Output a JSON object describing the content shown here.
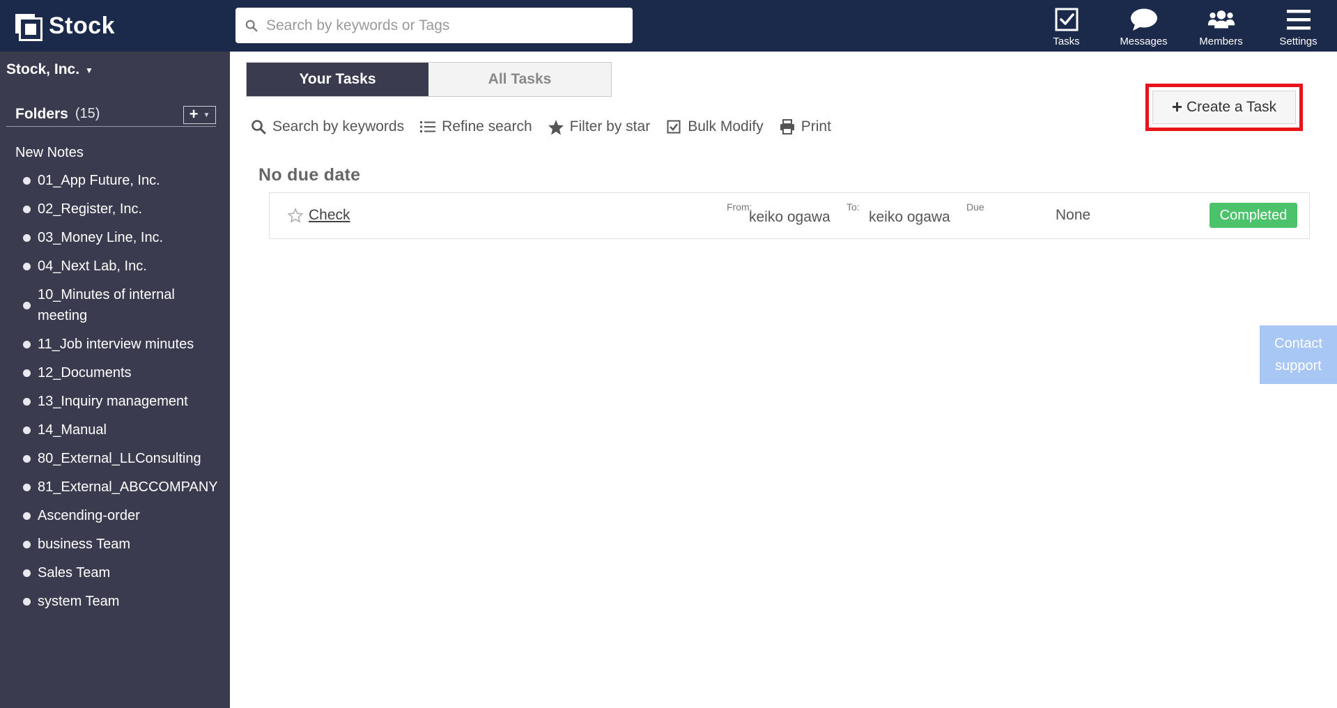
{
  "app": {
    "name": "Stock"
  },
  "header": {
    "search_placeholder": "Search by keywords or Tags",
    "nav": [
      {
        "label": "Tasks",
        "icon": "tasks-checkbox-icon"
      },
      {
        "label": "Messages",
        "icon": "chat-bubble-icon"
      },
      {
        "label": "Members",
        "icon": "members-group-icon"
      },
      {
        "label": "Settings",
        "icon": "hamburger-menu-icon"
      }
    ]
  },
  "sidebar": {
    "org_name": "Stock, Inc.",
    "folders_label": "Folders",
    "folders_count": "(15)",
    "new_notes": "New Notes",
    "folders": [
      "01_App Future, Inc.",
      "02_Register, Inc.",
      "03_Money Line, Inc.",
      "04_Next Lab, Inc.",
      "10_Minutes of internal meeting",
      "11_Job interview minutes",
      "12_Documents",
      "13_Inquiry management",
      "14_Manual",
      "80_External_LLConsulting",
      "81_External_ABCCOMPANY",
      "Ascending-order",
      "business Team",
      "Sales Team",
      "system Team"
    ]
  },
  "main": {
    "tabs": {
      "active": "Your Tasks",
      "inactive": "All Tasks"
    },
    "toolbar": {
      "search": "Search by keywords",
      "refine": "Refine search",
      "filter_star": "Filter by star",
      "bulk_modify": "Bulk Modify",
      "print": "Print"
    },
    "create_task": "Create a Task",
    "section_title": "No due date",
    "tasks": [
      {
        "name": "Check",
        "from_label": "From:",
        "from": "keiko ogawa",
        "to_label": "To:",
        "to": "keiko ogawa",
        "due_label": "Due",
        "due": "None",
        "status": "Completed"
      }
    ]
  },
  "contact_support": {
    "line1": "Contact",
    "line2": "support"
  },
  "colors": {
    "header_bg": "#1b2a4a",
    "sidebar_bg": "#3b3b4f",
    "status_completed": "#4cc26a",
    "highlight": "#e8131b",
    "contact_bg": "#a9c7f5"
  }
}
